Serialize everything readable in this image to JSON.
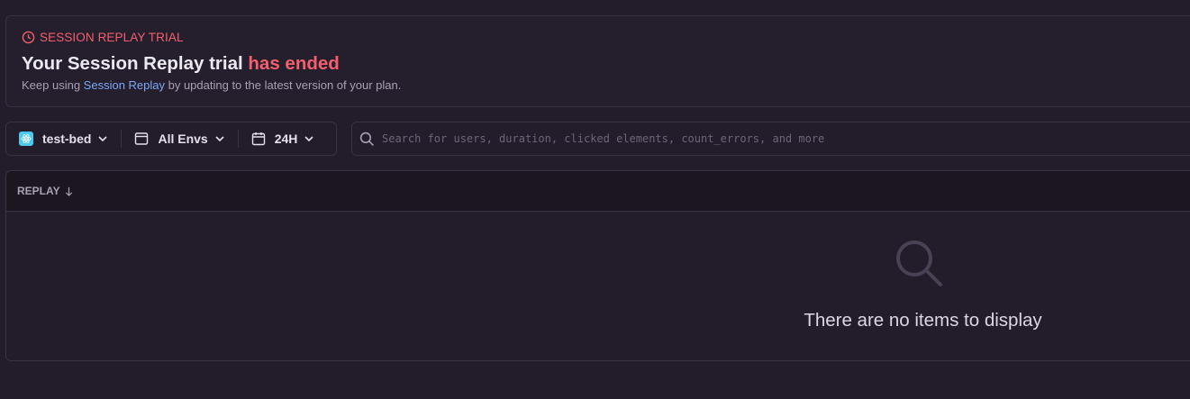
{
  "banner": {
    "tag": "SESSION REPLAY TRIAL",
    "tag_icon": "clock-icon",
    "title_main": "Your Session Replay trial ",
    "title_accent": "has ended",
    "desc_prefix": "Keep using ",
    "desc_link": "Session Replay",
    "desc_suffix": " by updating to the latest version of your plan."
  },
  "filters": {
    "project": {
      "label": "test-bed",
      "icon": "react-icon"
    },
    "environment": {
      "label": "All Envs",
      "icon": "window-icon"
    },
    "date_range": {
      "label": "24H",
      "icon": "calendar-icon"
    }
  },
  "search": {
    "placeholder": "Search for users, duration, clicked elements, count_errors, and more",
    "value": ""
  },
  "table": {
    "column_header": "REPLAY",
    "sort_icon": "arrow-down-icon",
    "empty_message": "There are no items to display",
    "empty_icon": "magnifier-icon"
  },
  "colors": {
    "accent_red": "#f55f6d",
    "link_blue": "#7aa9f5",
    "background": "#231c2b",
    "react_badge": "#4cc9f0"
  }
}
